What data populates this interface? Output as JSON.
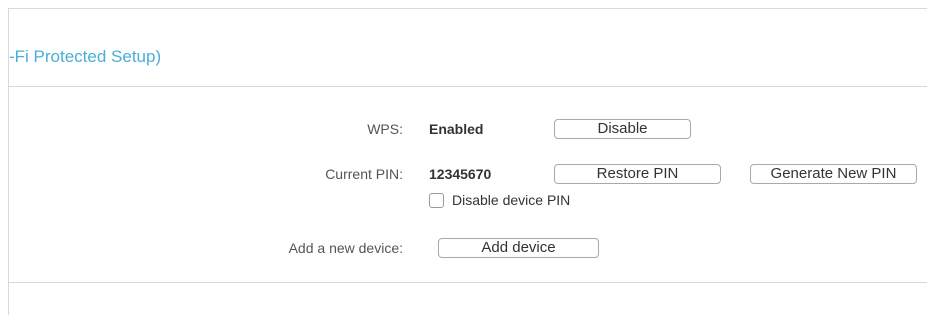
{
  "header": {
    "title": "-Fi Protected Setup)"
  },
  "wps": {
    "label": "WPS:",
    "status": "Enabled",
    "toggle_button": "Disable"
  },
  "pin": {
    "label": "Current PIN:",
    "value": "12345670",
    "restore_button": "Restore PIN",
    "generate_button": "Generate New PIN",
    "disable_checkbox_label": "Disable device PIN",
    "disable_checkbox_checked": false
  },
  "add_device": {
    "label": "Add a new device:",
    "button": "Add device"
  },
  "colors": {
    "title": "#4aaed9",
    "divider": "#d9d9d9",
    "button_border": "#a9a9a9"
  }
}
